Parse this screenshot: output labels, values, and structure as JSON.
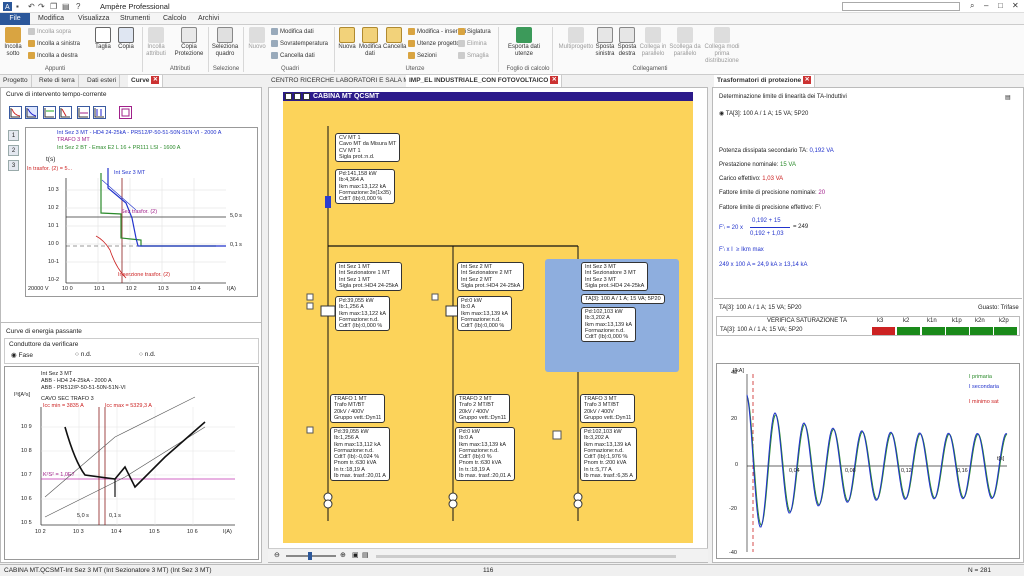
{
  "app": {
    "title": "Ampère Professional",
    "qa_icons": [
      "save-icon",
      "undo-icon",
      "redo-icon",
      "copy-icon",
      "paste-icon",
      "help-icon"
    ]
  },
  "menu": {
    "file": "File",
    "items": [
      "Modifica",
      "Visualizza",
      "Strumenti",
      "Calcolo",
      "Archivi"
    ]
  },
  "ribbon": {
    "incolla": "Incolla\nsotto",
    "incolla_sopra": "Incolla sopra",
    "incolla_sinistra": "Incolla a sinistra",
    "incolla_destra": "Incolla a destra",
    "taglia": "Taglia",
    "copia": "Copia",
    "incolla_attributi": "Incolla\nattributi",
    "copia_protezione": "Copia\nProtezione",
    "seleziona_quadro": "Seleziona\nquadro",
    "nuovo": "Nuovo",
    "modifica_dati": "Modifica dati",
    "sovratemperatura": "Sovratemperatura",
    "cancella_dati": "Cancella dati",
    "nuova": "Nuova",
    "modifica_dati2": "Modifica\ndati",
    "cancella": "Cancella",
    "modifica_inserisci": "Modifica - inserisci",
    "utenze_progetto": "Utenze progetto",
    "sezioni": "Sezioni",
    "siglatura": "Siglatura",
    "elimina": "Elimina",
    "smaglia": "Smaglia",
    "esporta": "Esporta dati\nutenze",
    "multiprogetto": "Multiprogetto",
    "sposta_sx": "Sposta\nsinistra",
    "sposta_dx": "Sposta\ndestra",
    "collega_parallelo": "Collega in\nparallelo",
    "scollega_parallelo": "Scollega da\nparallelo",
    "collega_modi": "Collega modi\nprima\ndistribuzione",
    "groups": [
      "Appunti",
      "Attributi",
      "Selezione",
      "Quadri",
      "Utenze",
      "Foglio di calcolo",
      "Collegamenti"
    ]
  },
  "tabs": {
    "left": [
      "Progetto",
      "Rete di terra",
      "Dati esteri",
      "Curve"
    ],
    "center": [
      "CENTRO RICERCHE LABORATORI E SALA MENSA",
      "IMP_EL INDUSTRIALE_CON FOTOVOLTAICO"
    ],
    "right": [
      "Trasformatori di protezione"
    ]
  },
  "left": {
    "curve_title": "Curve di intervento tempo-corrente",
    "legend": [
      {
        "n": "1",
        "text": "Int Sez 3 MT - HD4 24-25kA - PR512/P-50-51-50N-51N-VI - 2000 A",
        "color": "#2233cc"
      },
      {
        "n": "2",
        "text": "TRAFO 3 MT",
        "color": "#a0208a"
      },
      {
        "n": "3",
        "text": "Int Sez 2 BT - Emax E2 L 16 + PR111 LSI - 1600 A",
        "color": "#2a8a2a"
      }
    ],
    "graph1": {
      "tlabel": "t(s)",
      "ilabel": "I(A)",
      "ylab": [
        "10 3",
        "10 2",
        "10 1",
        "10 0",
        "10-1",
        "10-2"
      ],
      "xlab": [
        "20000 V",
        "10 0",
        "10 1",
        "10 2",
        "10 3",
        "10 4"
      ],
      "inrush": "In trasfor. (2) = 5...",
      "int_sez": "Int Sez 3 MT",
      "sez_trasfor": "Sez trasfor. (2)",
      "ins_trasfor": "Inserzione trasfor. (2)",
      "t5": "5,0 s",
      "t01": "0,1 s"
    },
    "energy_title": "Curve di energia passante",
    "conductor_title": "Conduttore da verificare",
    "radio": [
      "Fase",
      "n.d.",
      "n.d."
    ],
    "graph2": {
      "leg1": "Int Sez 3 MT",
      "leg2": "ABB - HD4 24-25kA - 2000 A",
      "leg3": "ABB - PR512/P-50-51-50N-51N-VI",
      "cavo": "CAVO SEC TRAFO 3",
      "icc_min": "Icc min = 3835 A",
      "icc_max": "Icc max = 5329,3 A",
      "k2s2": "K²S² = 1,0E7",
      "ylabel": "I²t[A²s]",
      "ilabel": "I(A)",
      "t5": "5,0 s",
      "t01": "0,1 s",
      "ylab": [
        "10 9",
        "10 8",
        "10 7",
        "10 6",
        "10 5"
      ],
      "xlab": [
        "10 2",
        "10 3",
        "10 4",
        "10 5",
        "10 6"
      ]
    }
  },
  "center": {
    "title": "CABINA MT QCSMT",
    "boxes": {
      "cv": "CV MT 1\nCavo MT da Misura MT\nCV MT 1\nSigla prot.:n.d.",
      "cv_data": "Pd:141,158 kW\nIb:4,364 A\nIkm max:13,122 kA\nFormazione:3x(1x35)\nCdtT (Ib):0,000 %",
      "s1": "Int Sez 1 MT\nInt Sezionatore 1 MT\nInt Sez 1 MT\nSigla prot.:HD4 24-25kA",
      "s1_data": "Pd:39,055 kW\nIb:1,256 A\nIkm max:13,122 kA\nFormazione:n.d.\nCdtT (Ib):0,000 %",
      "s2": "Int Sez 2 MT\nInt Sezionatore 2 MT\nInt Sez 2 MT\nSigla prot.:HD4 24-25kA",
      "s2_data": "Pd:0 kW\nIb:0 A\nIkm max:13,139 kA\nFormazione:n.d.\nCdtT (Ib):0,000 %",
      "s3": "Int Sez 3 MT\nInt Sezionatore 3 MT\nInt Sez 3 MT\nSigla prot.:HD4 24-25kA",
      "s3_ta": "TA[3]: 100 A / 1 A; 15 VA; 5P20",
      "s3_data": "Pd:102,103 kW\nIb:3,202 A\nIkm max:13,139 kA\nFormazione:n.d.\nCdtT (Ib):0,000 %",
      "t1": "TRAFO 1 MT\nTrafo MT/BT\n20kV / 400V\nGruppo vett.:Dyn11",
      "t1_data": "Pd:39,055 kW\nIb:1,256 A\nIkm max:13,112 kA\nFormazione:n.d.\nCdtT (Ib):-0,024 %\nPnom tr.:630 kVA\nIn tr.:18,19 A\nIb max. trasf.:20,01 A",
      "t2": "TRAFO 2 MT\nTrafo 2 MT/BT\n20kV / 400V\nGruppo vett.:Dyn11",
      "t2_data": "Pd:0 kW\nIb:0 A\nIkm max:13,139 kA\nFormazione:n.d.\nCdtT (Ib):0 %\nPnom tr.:630 kVA\nIn tr.:18,19 A\nIb max. trasf.:20,01 A",
      "t3": "TRAFO 3 MT\nTrafo 3 MT/BT\n20kV / 400V\nGruppo vett.:Dyn11",
      "t3_data": "Pd:102,103 kW\nIb:3,202 A\nIkm max:13,139 kA\nFormazione:n.d.\nCdtT (Ib):1,976 %\nPnom tr.:200 kVA\nIn tr.:5,77 A\nIb max. trasf.:6,35 A"
    },
    "page": "116"
  },
  "right": {
    "title": "Determinazione limite di linearità dei TA-Induttivi",
    "ta_option": "TA[3]: 100 A / 1 A; 15 VA; 5P20",
    "pot": "Potenza dissipata secondario TA:",
    "pot_v": "0,192 VA",
    "prest": "Prestazione nominale:",
    "prest_v": "15 VA",
    "carico": "Carico effettivo:",
    "carico_v": "1,03 VA",
    "flpn": "Fattore limite di precisione nominale:",
    "flpn_v": "20",
    "flpe": "Fattore limite di precisione effettivo:",
    "flpe_v": "F'ₗ",
    "formula_f": "F'ₗ = 20 x",
    "num": "0,192 + 15",
    "den": "0,192 + 1,03",
    "res": "= 249",
    "f2a": "F'ₗ x I",
    "f2b": "≥ Ikm max",
    "f3": "249 x 100 A = 24,9 kA ≥ 13,14 kA",
    "ta_sel": "TA[3]: 100 A / 1 A; 15 VA; 5P20",
    "guasto": "Guasto: Trifase",
    "tbl_title": "VERIFICA SATURAZIONE TA",
    "cols": [
      "k3",
      "k2",
      "k1n",
      "k1p",
      "k2n",
      "k2p"
    ],
    "row": "TA[3]: 100 A / 1 A; 15 VA; 5P20",
    "cells": [
      "#cc2222",
      "#1a8a1a",
      "#1a8a1a",
      "#1a8a1a",
      "#1a8a1a",
      "#1a8a1a"
    ],
    "wave": {
      "ylabel": "I[kA]",
      "xlabel": "t[s]",
      "legend": [
        "I primaria",
        "I secondaria",
        "I minimo sat"
      ],
      "yt": [
        "40",
        "20",
        "0",
        "-20",
        "-40"
      ],
      "xt": [
        "0,04",
        "0,08",
        "0,12",
        "0,16"
      ]
    }
  },
  "status": {
    "left": "CABINA MT.QCSMT-Int Sez 3 MT (Int Sezionatore 3 MT) (Int Sez 3 MT)",
    "mid": "116",
    "right": "N = 281"
  }
}
